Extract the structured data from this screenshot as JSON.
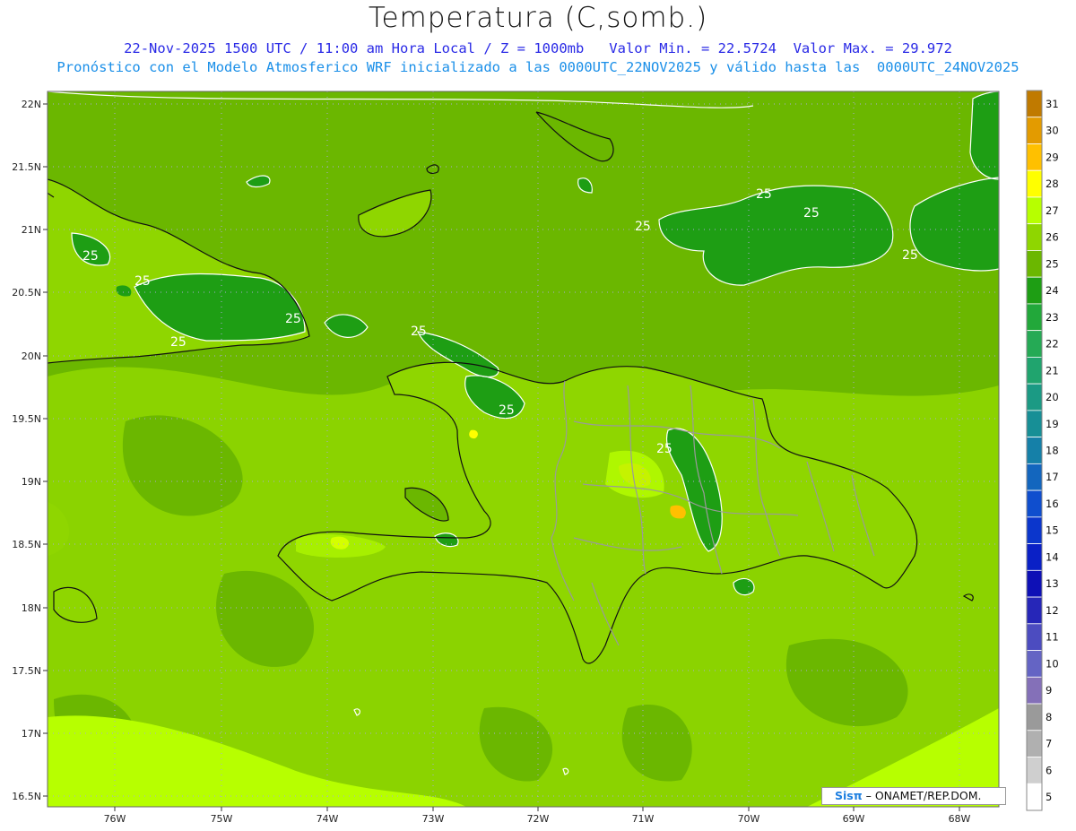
{
  "header": {
    "title": "Temperatura (C,somb.)",
    "line1": "22-Nov-2025 1500 UTC / 11:00 am Hora Local / Z = 1000mb   Valor Min. = 22.5724  Valor Max. = 29.972",
    "line2": "Pronóstico con el Modelo Atmosferico WRF inicializado a las 0000UTC_22NOV2025 y válido hasta las  0000UTC_24NOV2025"
  },
  "map": {
    "lat_labels": [
      "22N",
      "21.5N",
      "21N",
      "20.5N",
      "20N",
      "19.5N",
      "19N",
      "18.5N",
      "18N",
      "17.5N",
      "17N",
      "16.5N"
    ],
    "lon_labels": [
      "76W",
      "75W",
      "74W",
      "73W",
      "72W",
      "71W",
      "70W",
      "69W",
      "68W"
    ],
    "contour_label": "25"
  },
  "colorbar": {
    "levels": [
      {
        "label": "31",
        "color": "#c07a00"
      },
      {
        "label": "30",
        "color": "#e39b00"
      },
      {
        "label": "29",
        "color": "#ffc000"
      },
      {
        "label": "28",
        "color": "#ffff00"
      },
      {
        "label": "27",
        "color": "#b7ff00"
      },
      {
        "label": "26",
        "color": "#8fd600"
      },
      {
        "label": "25",
        "color": "#6bb700"
      },
      {
        "label": "24",
        "color": "#1e9e14"
      },
      {
        "label": "23",
        "color": "#22a83a"
      },
      {
        "label": "22",
        "color": "#25aa55"
      },
      {
        "label": "21",
        "color": "#20a46e"
      },
      {
        "label": "20",
        "color": "#1b9a84"
      },
      {
        "label": "19",
        "color": "#178f96"
      },
      {
        "label": "18",
        "color": "#1580a8"
      },
      {
        "label": "17",
        "color": "#1366be"
      },
      {
        "label": "16",
        "color": "#0f4ece"
      },
      {
        "label": "15",
        "color": "#0b36cc"
      },
      {
        "label": "14",
        "color": "#0a20c6"
      },
      {
        "label": "13",
        "color": "#0e10b6"
      },
      {
        "label": "12",
        "color": "#2626b8"
      },
      {
        "label": "11",
        "color": "#4c4cc0"
      },
      {
        "label": "10",
        "color": "#6464c4"
      },
      {
        "label": "9",
        "color": "#8470b8"
      },
      {
        "label": "8",
        "color": "#9a9a9a"
      },
      {
        "label": "7",
        "color": "#b0b0b0"
      },
      {
        "label": "6",
        "color": "#cfcfcf"
      },
      {
        "label": "5",
        "color": "#ffffff"
      }
    ]
  },
  "credit": {
    "brand": "Sisπ",
    "text": "– ONAMET/REP.DOM."
  }
}
